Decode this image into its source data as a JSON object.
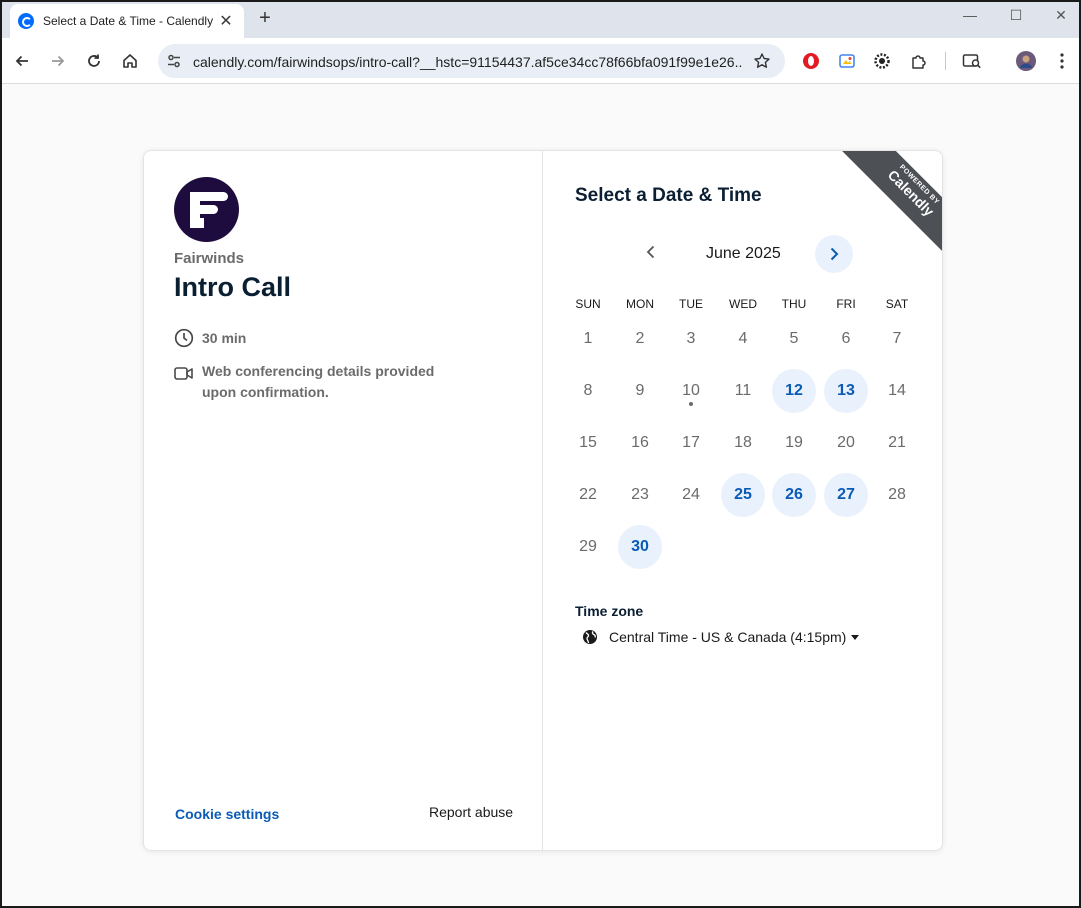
{
  "browser": {
    "tab_title": "Select a Date & Time - Calendly",
    "url": "calendly.com/fairwindsops/intro-call?__hstc=91154437.af5ce34cc78f66bfa091f99e1e26...",
    "close_glyph": "✕",
    "new_tab_glyph": "+",
    "minimize_glyph": "—",
    "maximize_glyph": "☐",
    "window_close_glyph": "✕"
  },
  "host": {
    "org_name": "Fairwinds",
    "event_name": "Intro Call",
    "duration": "30 min",
    "conferencing": "Web conferencing details provided upon confirmation.",
    "cookie_settings": "Cookie settings",
    "report_abuse": "Report abuse"
  },
  "badge": {
    "line1": "POWERED BY",
    "line2": "Calendly"
  },
  "calendar": {
    "title": "Select a Date & Time",
    "month": "June 2025",
    "weekdays": [
      "SUN",
      "MON",
      "TUE",
      "WED",
      "THU",
      "FRI",
      "SAT"
    ],
    "days": [
      "1",
      "2",
      "3",
      "4",
      "5",
      "6",
      "7",
      "8",
      "9",
      "10",
      "11",
      "12",
      "13",
      "14",
      "15",
      "16",
      "17",
      "18",
      "19",
      "20",
      "21",
      "22",
      "23",
      "24",
      "25",
      "26",
      "27",
      "28",
      "29",
      "30"
    ],
    "available_days": [
      "12",
      "13",
      "25",
      "26",
      "27",
      "30"
    ],
    "today": "10"
  },
  "timezone": {
    "label": "Time zone",
    "value": "Central Time - US & Canada (4:15pm)"
  },
  "colors": {
    "accent": "#0a5bb5",
    "available_bg": "#e9f1fd",
    "logo_bg": "#1f0c3e",
    "ribbon": "#4d5055"
  }
}
